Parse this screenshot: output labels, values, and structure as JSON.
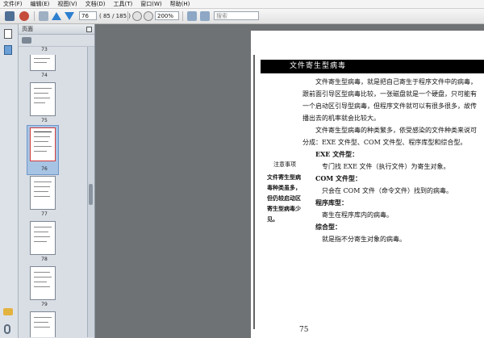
{
  "menu": [
    "文件(F)",
    "编辑(E)",
    "视图(V)",
    "文档(D)",
    "工具(T)",
    "窗口(W)",
    "帮助(H)"
  ],
  "toolbar": {
    "page_current": "76",
    "page_total": "( 85 / 185 )",
    "zoom": "200%",
    "search_placeholder": "搜索"
  },
  "panel": {
    "title": "页面"
  },
  "thumbnails": [
    {
      "num": "73",
      "selected": false
    },
    {
      "num": "74",
      "selected": false
    },
    {
      "num": "75",
      "selected": false
    },
    {
      "num": "76",
      "selected": true
    },
    {
      "num": "77",
      "selected": false
    },
    {
      "num": "78",
      "selected": false
    },
    {
      "num": "79",
      "selected": false
    }
  ],
  "document": {
    "section_title": "文件寄生型病毒",
    "paragraphs": [
      {
        "cls": "ind",
        "text": "文件寄生型病毒，就是把自己寄生于程序文件中的病毒，跟前面引导区型病毒比较，一张磁盘就是一个硬盘，只可能有一个启动区引导型病毒，但程序文件就可以有很多很多，故传播出去的机率就会比较大。"
      },
      {
        "cls": "ind",
        "text": "文件寄生型病毒的种类繁多，依受感染的文件种类来说可分成：EXE 文件型、COM 文件型、程序库型和综合型。"
      },
      {
        "cls": "sub",
        "text": "EXE 文件型："
      },
      {
        "cls": "txt",
        "text": "专门找 EXE 文件（执行文件）为寄生对象。"
      },
      {
        "cls": "sub",
        "text": "COM 文件型："
      },
      {
        "cls": "txt",
        "text": "只会在 COM 文件（命令文件）找到的病毒。"
      },
      {
        "cls": "sub",
        "text": "程序库型："
      },
      {
        "cls": "txt",
        "text": "寄生在程序库内的病毒。"
      },
      {
        "cls": "sub",
        "text": "综合型："
      },
      {
        "cls": "txt",
        "text": "就是指不分寄生对象的病毒。"
      }
    ],
    "sidenote_heading": "注意事项",
    "sidenote_text": "文件寄生型病毒种类虽多，但仍较启动区寄生型病毒少见。",
    "page_number": "75"
  }
}
